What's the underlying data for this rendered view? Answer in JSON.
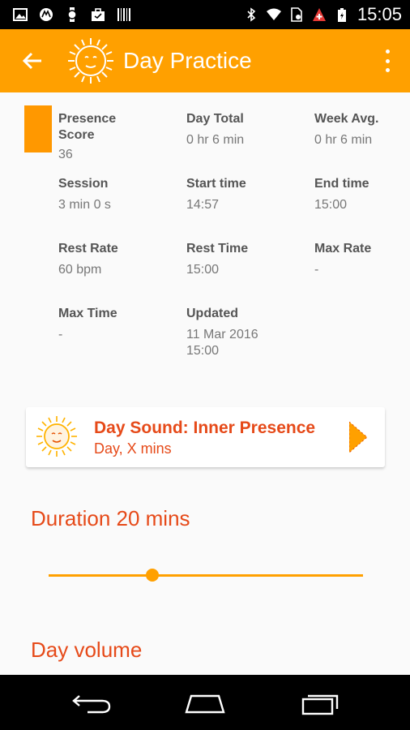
{
  "status_bar": {
    "time": "15:05",
    "left_icons": [
      "image-icon",
      "motorola-icon",
      "watch-icon",
      "briefcase-icon",
      "barcode-icon"
    ],
    "right_icons": [
      "bluetooth-icon",
      "wifi-icon",
      "battery-saver-icon",
      "medical-alert-icon",
      "battery-icon"
    ]
  },
  "app_bar": {
    "title": "Day Practice",
    "back_icon": "arrow-back-icon",
    "logo": "sun-face-logo",
    "menu_icon": "overflow-menu-icon",
    "color": "#ffa000"
  },
  "stats": [
    {
      "label": "Presence Score",
      "value": "36"
    },
    {
      "label": "Day Total",
      "value": "0 hr 6 min"
    },
    {
      "label": "Week Avg.",
      "value": "0 hr 6 min"
    },
    {
      "label": "Session",
      "value": "3 min 0 s"
    },
    {
      "label": "Start time",
      "value": "14:57"
    },
    {
      "label": "End time",
      "value": "15:00"
    },
    {
      "label": "Rest Rate",
      "value": "60 bpm"
    },
    {
      "label": "Rest Time",
      "value": "15:00"
    },
    {
      "label": "Max Rate",
      "value": "-"
    },
    {
      "label": "Max Time",
      "value": "-"
    },
    {
      "label": "Updated",
      "value": "11 Mar 2016 15:00"
    }
  ],
  "sound_card": {
    "title": "Day Sound: Inner Presence",
    "subtitle": "Day, X mins",
    "accent": "#e64a19"
  },
  "duration": {
    "label": "Duration 20 mins",
    "slider_fraction": 0.33
  },
  "volume": {
    "label": "Day volume"
  },
  "nav_bar": {
    "buttons": [
      "back-icon",
      "home-icon",
      "recents-icon"
    ]
  }
}
